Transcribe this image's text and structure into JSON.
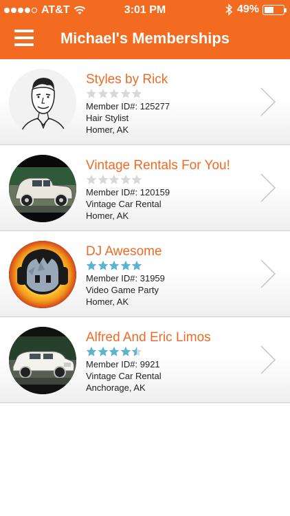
{
  "status_bar": {
    "carrier": "AT&T",
    "time": "3:01 PM",
    "battery": "49%",
    "battery_level": 0.49,
    "signal_bars_filled": 4,
    "signal_bars_total": 5
  },
  "nav": {
    "title": "Michael's Memberships",
    "menu_icon": "hamburger-menu-icon"
  },
  "colors": {
    "accent": "#f36b21",
    "title_text": "#ef6a24",
    "star_filled": "#5ab4cf",
    "star_empty": "#d8d8d8"
  },
  "memberships": [
    {
      "name": "Styles by Rick",
      "rating": 0,
      "member_id": "Member ID#: 125277",
      "category": "Hair Stylist",
      "location": "Homer, AK",
      "avatar": "caricature-portrait"
    },
    {
      "name": "Vintage Rentals For You!",
      "rating": 0,
      "member_id": "Member ID#: 120159",
      "category": "Vintage Car Rental",
      "location": "Homer, AK",
      "avatar": "vintage-car-photo"
    },
    {
      "name": "DJ Awesome",
      "rating": 5,
      "member_id": "Member ID#: 31959",
      "category": "Video Game Party",
      "location": "Homer, AK",
      "avatar": "dj-character-with-headphones"
    },
    {
      "name": "Alfred And Eric Limos",
      "rating": 4.5,
      "member_id": "Member ID#: 9921",
      "category": "Vintage Car Rental",
      "location": "Anchorage, AK",
      "avatar": "white-limo-photo"
    }
  ]
}
